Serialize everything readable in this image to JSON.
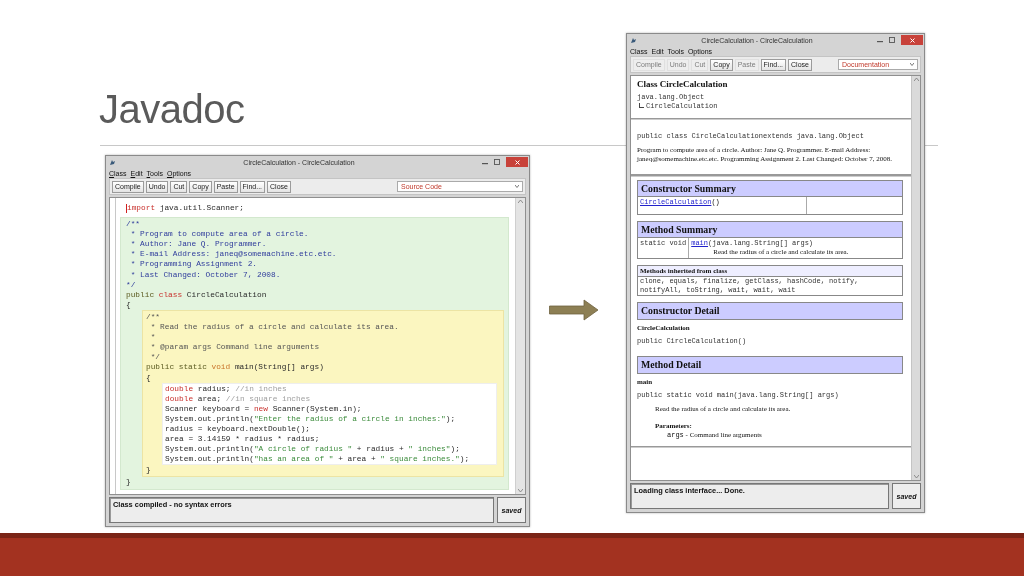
{
  "slide": {
    "title": "Javadoc"
  },
  "windows": [
    {
      "title": "CircleCalculation - CircleCalculation",
      "mnemonics_shown": true,
      "menu": [
        "Class",
        "Edit",
        "Tools",
        "Options"
      ],
      "toolbar": [
        {
          "label": "Compile",
          "disabled": false
        },
        {
          "label": "Undo",
          "disabled": false
        },
        {
          "label": "Cut",
          "disabled": false
        },
        {
          "label": "Copy",
          "disabled": false
        },
        {
          "label": "Paste",
          "disabled": false
        },
        {
          "label": "Find...",
          "disabled": false
        },
        {
          "label": "Close",
          "disabled": false
        }
      ],
      "view_selector": "Source Code",
      "editor": {
        "kind": "source",
        "caret_shown": true,
        "items": [
          {
            "kind": "line",
            "segments": [
              {
                "kind": "keyword",
                "text": "import"
              },
              {
                "kind": "plain",
                "text": " java.util.Scanner;"
              }
            ]
          },
          {
            "kind": "class",
            "items": [
              {
                "kind": "line",
                "segments": [
                  {
                    "kind": "doc",
                    "text": "/**"
                  }
                ]
              },
              {
                "kind": "line",
                "segments": [
                  {
                    "kind": "doc",
                    "text": " * Program to compute area of a circle."
                  }
                ]
              },
              {
                "kind": "line",
                "segments": [
                  {
                    "kind": "doc",
                    "text": " * Author: Jane Q. Programmer."
                  }
                ]
              },
              {
                "kind": "line",
                "segments": [
                  {
                    "kind": "doc",
                    "text": " * E-mail Address: janeq@somemachine.etc.etc."
                  }
                ]
              },
              {
                "kind": "line",
                "segments": [
                  {
                    "kind": "doc",
                    "text": " * Programming Assignment 2."
                  }
                ]
              },
              {
                "kind": "line",
                "segments": [
                  {
                    "kind": "doc",
                    "text": " * Last Changed: October 7, 2008."
                  }
                ]
              },
              {
                "kind": "line",
                "segments": [
                  {
                    "kind": "doc",
                    "text": "*/"
                  }
                ]
              },
              {
                "kind": "line",
                "segments": [
                  {
                    "kind": "modifier",
                    "text": "public "
                  },
                  {
                    "kind": "keyword",
                    "text": "class"
                  },
                  {
                    "kind": "plain",
                    "text": " CircleCalculation"
                  }
                ]
              },
              {
                "kind": "line",
                "segments": [
                  {
                    "kind": "plain",
                    "text": "{"
                  }
                ]
              },
              {
                "kind": "method",
                "items": [
                  {
                    "kind": "line",
                    "segments": [
                      {
                        "kind": "comment",
                        "text": "/**"
                      }
                    ]
                  },
                  {
                    "kind": "line",
                    "segments": [
                      {
                        "kind": "comment",
                        "text": " * Read the radius of a circle and calculate its area."
                      }
                    ]
                  },
                  {
                    "kind": "line",
                    "segments": [
                      {
                        "kind": "comment",
                        "text": " *"
                      }
                    ]
                  },
                  {
                    "kind": "line",
                    "segments": [
                      {
                        "kind": "comment",
                        "text": " * @param args Command line arguments"
                      }
                    ]
                  },
                  {
                    "kind": "line",
                    "segments": [
                      {
                        "kind": "comment",
                        "text": " */"
                      }
                    ]
                  },
                  {
                    "kind": "line",
                    "segments": [
                      {
                        "kind": "modifier",
                        "text": "public static "
                      },
                      {
                        "kind": "type",
                        "text": "void"
                      },
                      {
                        "kind": "plain",
                        "text": " main(String[] args)"
                      }
                    ]
                  },
                  {
                    "kind": "line",
                    "segments": [
                      {
                        "kind": "plain",
                        "text": "{"
                      }
                    ]
                  },
                  {
                    "kind": "body",
                    "items": [
                      {
                        "kind": "line",
                        "segments": [
                          {
                            "kind": "keyword",
                            "text": "double"
                          },
                          {
                            "kind": "plain",
                            "text": " radius; "
                          },
                          {
                            "kind": "linecomment",
                            "text": "//in inches"
                          }
                        ]
                      },
                      {
                        "kind": "line",
                        "segments": [
                          {
                            "kind": "keyword",
                            "text": "double"
                          },
                          {
                            "kind": "plain",
                            "text": " area; "
                          },
                          {
                            "kind": "linecomment",
                            "text": "//in square inches"
                          }
                        ]
                      },
                      {
                        "kind": "line",
                        "segments": [
                          {
                            "kind": "plain",
                            "text": "Scanner keyboard = "
                          },
                          {
                            "kind": "keyword",
                            "text": "new"
                          },
                          {
                            "kind": "plain",
                            "text": " Scanner(System.in);"
                          }
                        ]
                      },
                      {
                        "kind": "line",
                        "segments": [
                          {
                            "kind": "plain",
                            "text": "System.out.println("
                          },
                          {
                            "kind": "string",
                            "text": "\"Enter the radius of a circle in inches:\""
                          },
                          {
                            "kind": "plain",
                            "text": ");"
                          }
                        ]
                      },
                      {
                        "kind": "line",
                        "segments": [
                          {
                            "kind": "plain",
                            "text": "radius = keyboard.nextDouble();"
                          }
                        ]
                      },
                      {
                        "kind": "line",
                        "segments": [
                          {
                            "kind": "plain",
                            "text": "area = 3.14159 * radius * radius;"
                          }
                        ]
                      },
                      {
                        "kind": "line",
                        "segments": [
                          {
                            "kind": "plain",
                            "text": "System.out.println("
                          },
                          {
                            "kind": "string",
                            "text": "\"A circle of radius \""
                          },
                          {
                            "kind": "plain",
                            "text": " + radius + "
                          },
                          {
                            "kind": "string",
                            "text": "\" inches\""
                          },
                          {
                            "kind": "plain",
                            "text": ");"
                          }
                        ]
                      },
                      {
                        "kind": "line",
                        "segments": [
                          {
                            "kind": "plain",
                            "text": "System.out.println("
                          },
                          {
                            "kind": "string",
                            "text": "\"has an area of \""
                          },
                          {
                            "kind": "plain",
                            "text": " + area + "
                          },
                          {
                            "kind": "string",
                            "text": "\" square inches.\""
                          },
                          {
                            "kind": "plain",
                            "text": ");"
                          }
                        ]
                      }
                    ]
                  },
                  {
                    "kind": "line",
                    "segments": [
                      {
                        "kind": "plain",
                        "text": "}"
                      }
                    ]
                  }
                ]
              },
              {
                "kind": "line",
                "segments": [
                  {
                    "kind": "plain",
                    "text": "}"
                  }
                ]
              }
            ]
          }
        ]
      },
      "status": "Class compiled - no syntax errors",
      "saved_label": "saved"
    },
    {
      "title": "CircleCalculation - CircleCalculation",
      "mnemonics_shown": false,
      "menu": [
        "Class",
        "Edit",
        "Tools",
        "Options"
      ],
      "toolbar": [
        {
          "label": "Compile",
          "disabled": true
        },
        {
          "label": "Undo",
          "disabled": true
        },
        {
          "label": "Cut",
          "disabled": true
        },
        {
          "label": "Copy",
          "disabled": false
        },
        {
          "label": "Paste",
          "disabled": true
        },
        {
          "label": "Find...",
          "disabled": false
        },
        {
          "label": "Close",
          "disabled": false
        }
      ],
      "view_selector": "Documentation",
      "editor": {
        "kind": "documentation",
        "items": [
          {
            "kind": "heading",
            "text": "Class CircleCalculation"
          },
          {
            "kind": "hierarchy",
            "name": "java.lang.Object",
            "children": [
              {
                "name": "CircleCalculation"
              }
            ]
          },
          {
            "kind": "rule"
          },
          {
            "kind": "signature",
            "text": "public class CircleCalculationextends java.lang.Object"
          },
          {
            "kind": "paragraph",
            "text": "Program to compute area of a circle. Author: Jane Q. Programmer. E-mail Address: janeq@somemachine.etc.etc. Programming Assignment 2. Last Changed: October 7, 2008."
          },
          {
            "kind": "rule"
          },
          {
            "kind": "summary",
            "heading": "Constructor Summary",
            "rows": [
              {
                "link": "CircleCalculation",
                "signature": "()"
              }
            ]
          },
          {
            "kind": "summary",
            "heading": "Method Summary",
            "rows": [
              {
                "modifier": "static void",
                "link": "main",
                "signature": "(java.lang.String[] args)",
                "description": "Read the radius of a circle and calculate its area."
              }
            ]
          },
          {
            "kind": "inherited",
            "heading": "Methods inherited from class",
            "text": "clone, equals, finalize, getClass, hashCode, notify, notifyAll, toString, wait, wait, wait"
          },
          {
            "kind": "section",
            "text": "Constructor Detail"
          },
          {
            "kind": "member",
            "text": "CircleCalculation"
          },
          {
            "kind": "signature",
            "text": "public CircleCalculation()"
          },
          {
            "kind": "section",
            "text": "Method Detail"
          },
          {
            "kind": "member",
            "text": "main"
          },
          {
            "kind": "signature",
            "text": "public static void main(java.lang.String[] args)"
          },
          {
            "kind": "indented",
            "text": "Read the radius of a circle and calculate its area."
          },
          {
            "kind": "param-label",
            "text": "Parameters:"
          },
          {
            "kind": "param",
            "name": "args",
            "text": " - Command line arguments"
          },
          {
            "kind": "rule"
          }
        ]
      },
      "status": "Loading class interface... Done.",
      "saved_label": "saved"
    }
  ]
}
